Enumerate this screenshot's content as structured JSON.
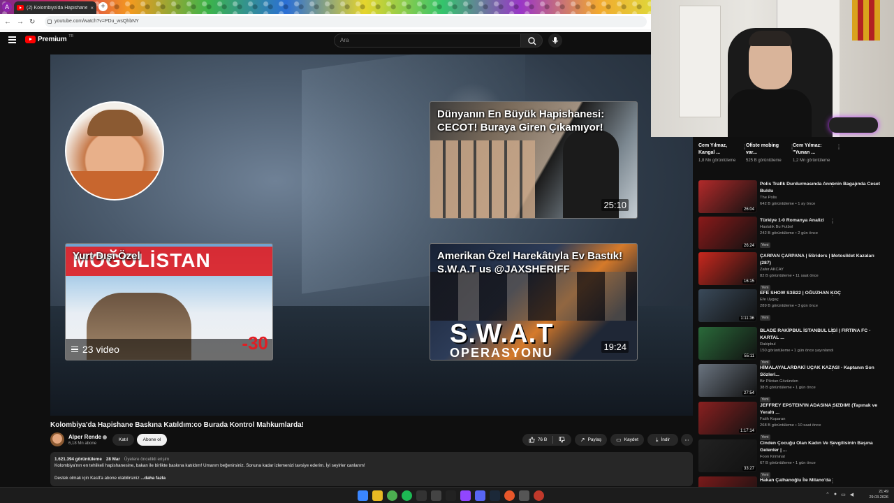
{
  "browser": {
    "profile_initial": "A",
    "tab_title": "(2) Kolombiya'da Hapishane B...",
    "tab_close": "×",
    "new_tab": "+",
    "url": "youtube.com/watch?v=PDu_wsQhbNY",
    "nav_back": "←",
    "nav_forward": "→",
    "nav_reload": "↻"
  },
  "youtube": {
    "logo_text": "Premium",
    "logo_region": "TR",
    "search_placeholder": "Ara"
  },
  "video": {
    "endscreen": {
      "card1": {
        "title": "Dünyanın En Büyük Hapishanesi: CECOT! Buraya Giren Çıkamıyor!",
        "duration": "25:10"
      },
      "card2": {
        "title": "Yurt Dışı Özel",
        "banner": "MOĞOLİSTAN",
        "playlist_count": "23 video",
        "badge": "-30"
      },
      "card3": {
        "title": "Amerikan Özel Harekâtıyla Ev Bastık! S.W.A.T us @JAXSHERIFF",
        "duration": "19:24",
        "overlay1": "S.W.A.T",
        "overlay2": "OPERASYONU"
      }
    },
    "title": "Kolombiya'da Hapishane Baskına Katıldım:co Burada Kontrol Mahkumlarda!",
    "channel": {
      "name": "Alper Rende",
      "subs": "6,18 Mn abone",
      "join": "Katıl",
      "subscribe": "Abone ol"
    },
    "actions": {
      "likes": "76 B",
      "share": "Paylaş",
      "save": "Kaydet",
      "download": "İndir",
      "more": "⋯"
    },
    "description": {
      "views": "1.621.394 görüntüleme",
      "date": "28 Mar",
      "access": "Üyelere öncelikli erişim",
      "line1": "Kolombiya'nın en tehlikeli hapishanesine, bakan ile birlikte baskına katıldım! Umarım beğenirsiniz. Sonuna kadar izlemenizi tavsiye ederim. İyi seyirler canlarım!",
      "line2": "Destek olmak için Kastl'a abone olabilirsiniz",
      "more": "...daha fazla"
    }
  },
  "shorts": [
    {
      "title": "Cem Yılmaz, Kangal ...",
      "views": "1,8 Mn görüntüleme"
    },
    {
      "title": "Ofiste mobing var...",
      "views": "525 B görüntüleme"
    },
    {
      "title": "Cem Yılmaz: \"Yunan ...",
      "views": "1,2 Mn görüntüleme"
    }
  ],
  "recommendations": [
    {
      "title": "Polis Trafik Durdurmasında Annenin Bagajında Ceset Buldu",
      "channel": "The Polis",
      "meta": "642 B görüntüleme • 1 ay önce",
      "duration": "26:04",
      "new": "",
      "color": "#b22a2a"
    },
    {
      "title": "Türkiye 1-0 Romanya Analizi",
      "channel": "Hastalık Bu Futbol",
      "meta": "242 B görüntüleme • 2 gün önce",
      "duration": "26:24",
      "new": "Yeni",
      "color": "#8a1a1a"
    },
    {
      "title": "ÇARPAN ÇARPANA | 5Sriders | Motosiklet Kazaları (287)",
      "channel": "Zafer AKCAY",
      "meta": "82 B görüntüleme • 11 saat önce",
      "duration": "16:15",
      "new": "Yeni",
      "color": "#c8281e"
    },
    {
      "title": "EFE SHOW S3B22 | OĞUZHAN KOÇ",
      "channel": "Efe Uygaç",
      "meta": "289 B görüntüleme • 3 gün önce",
      "duration": "1:11:36",
      "new": "Yeni",
      "color": "#3a4a5a"
    },
    {
      "title": "BLADE RAKİPBUL İSTANBUL LİGİ | FIRTINA FC - KARTAL ...",
      "channel": "Rakipbul",
      "meta": "150 görüntüleme • 1 gün önce yayınlandı",
      "duration": "55:11",
      "new": "Yeni",
      "color": "#2a6a3a"
    },
    {
      "title": "HİMALAYALARDAKİ UÇAK KAZASI - Kaptanın Son Sözleri...",
      "channel": "Bir Pilotun Gözünden",
      "meta": "38 B görüntüleme • 1 gün önce",
      "duration": "27:54",
      "new": "Yeni",
      "color": "#6a7480"
    },
    {
      "title": "JEFFREY EPSTEIN'IN ADASINA SIZDIM! (Tapınak ve Yeraltı ...",
      "channel": "Fatih Koparan",
      "meta": "268 B görüntüleme • 10 saat önce",
      "duration": "1:17:14",
      "new": "Yeni",
      "color": "#8a2020"
    },
    {
      "title": "Cinden Çocuğu Olan Kadın Ve Sevgilisinin Başına Gelenler | ...",
      "channel": "Foon Kriminal",
      "meta": "67 B görüntüleme • 1 gün önce",
      "duration": "33:27",
      "new": "Yeni",
      "color": "#222222"
    },
    {
      "title": "Hakan Çalhanoğlu İle Milano'da",
      "channel": "",
      "meta": "",
      "duration": "",
      "new": "",
      "color": "#7a1a1a"
    }
  ],
  "taskbar": {
    "time": "21:49",
    "date": "29.03.2026"
  }
}
